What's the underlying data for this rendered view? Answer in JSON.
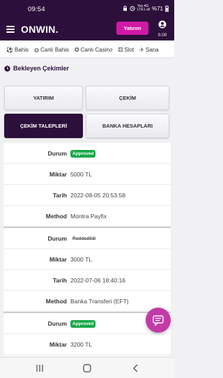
{
  "status_bar": {
    "time": "09:54",
    "net_top": "Yes 4G",
    "net_bottom": "LTE1 all",
    "battery": "%71"
  },
  "header": {
    "logo": "ONWIN.",
    "deposit_label": "Yatırım",
    "balance": "0.00"
  },
  "nav": {
    "items": [
      {
        "label": "Bahis",
        "icon": "soccer-ball-icon"
      },
      {
        "label": "Canlı Bahis",
        "icon": "live-ball-icon"
      },
      {
        "label": "Canlı Casino",
        "icon": "casino-chip-icon"
      },
      {
        "label": "Slot",
        "icon": "dice-icon"
      },
      {
        "label": "Sana",
        "icon": "plane-icon"
      }
    ]
  },
  "page": {
    "title": "Bekleyen Çekimler"
  },
  "tabs": {
    "deposit": "YATIRIM",
    "withdraw": "ÇEKİM",
    "withdraw_requests": "ÇEKİM TALEPLERİ",
    "bank_accounts": "BANKA HESAPLARI"
  },
  "labels": {
    "status": "Durum",
    "amount": "Miktar",
    "date": "Tarih",
    "method": "Method"
  },
  "records": [
    {
      "status": "Approved",
      "amount": "5000 TL",
      "date": "2022-08-05 20:53:58",
      "method": "Montra Payfix"
    },
    {
      "status": "Reddedildi",
      "amount": "3000 TL",
      "date": "2022-07-06 18:40:16",
      "method": "Banka Transferi (EFT)"
    },
    {
      "status": "Approved",
      "amount": "3200 TL"
    }
  ],
  "colors": {
    "brand_dark": "#2d0f3b",
    "accent_pink": "#d119a5",
    "approved_green": "#17a848",
    "chat_fab": "#c23ba7"
  }
}
